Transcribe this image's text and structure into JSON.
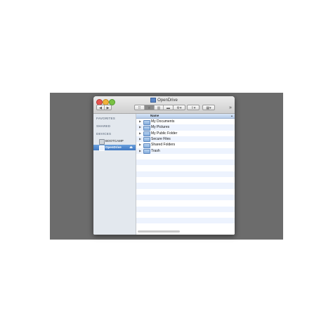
{
  "window": {
    "title": "OpenDrive",
    "overflow_label": "»"
  },
  "toolbar": {
    "back_label": "◀",
    "forward_label": "▶",
    "view_icon": "⠿",
    "list_icon": "≡",
    "column_icon": "▥",
    "coverflow_icon": "▬",
    "action_label": "⚙▾",
    "share_label": "⇪▾",
    "arrange_label": "▦▾"
  },
  "sidebar": {
    "favorites_heading": "FAVORITES",
    "shared_heading": "SHARED",
    "devices_heading": "DEVICES",
    "devices": [
      {
        "label": "BOOTCAMP",
        "selected": false
      },
      {
        "label": "OpenDrive",
        "selected": true
      }
    ],
    "eject_icon": "⏏"
  },
  "file_list": {
    "column_header": "Name",
    "sort_indicator": "▴",
    "disclosure": "▶",
    "items": [
      {
        "name": "My Documents"
      },
      {
        "name": "My Pictures"
      },
      {
        "name": "My Public Folder"
      },
      {
        "name": "Secure Files"
      },
      {
        "name": "Shared Folders"
      },
      {
        "name": "Trash"
      }
    ]
  },
  "colors": {
    "backdrop": "#6c6c6c",
    "selection": "#3f78c2",
    "stripe": "#edf3fe"
  }
}
